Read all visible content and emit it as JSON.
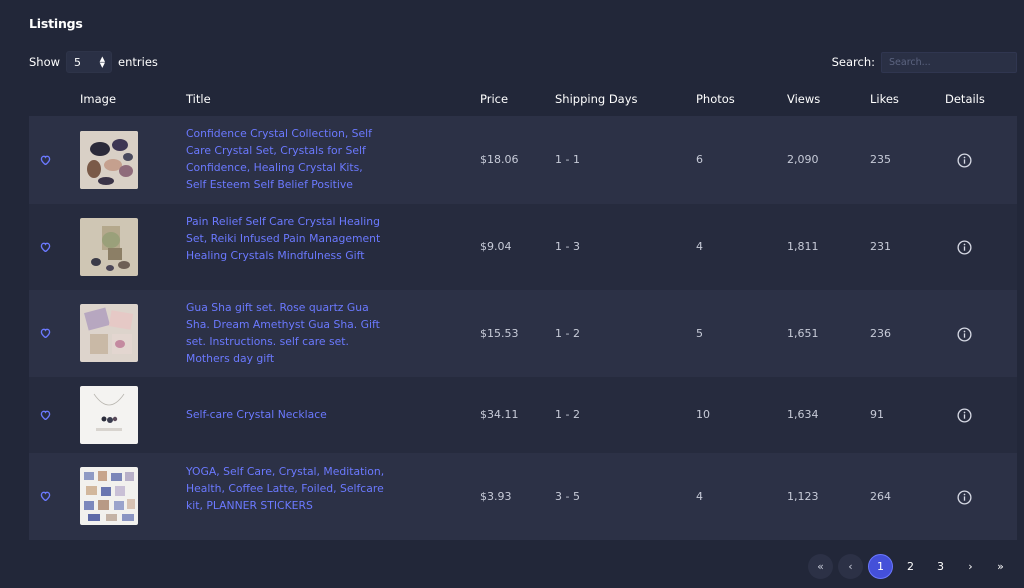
{
  "page_title": "Listings",
  "length_control": {
    "show_label": "Show",
    "value": "5",
    "entries_label": "entries"
  },
  "search": {
    "label": "Search:",
    "placeholder": "Search..."
  },
  "columns": [
    "Image",
    "Title",
    "Price",
    "Shipping Days",
    "Photos",
    "Views",
    "Likes",
    "Details"
  ],
  "rows": [
    {
      "title": "Confidence Crystal Collection, Self Care Crystal Set, Crystals for Self Confidence, Healing Crystal Kits, Self Esteem Self Belief Positive",
      "price": "$18.06",
      "shipping": "1 - 1",
      "photos": "6",
      "views": "2,090",
      "likes": "235"
    },
    {
      "title": "Pain Relief Self Care Crystal Healing Set, Reiki Infused Pain Management Healing Crystals Mindfulness Gift",
      "price": "$9.04",
      "shipping": "1 - 3",
      "photos": "4",
      "views": "1,811",
      "likes": "231"
    },
    {
      "title": "Gua Sha gift set. Rose quartz Gua Sha. Dream Amethyst Gua Sha. Gift set. Instructions. self care set. Mothers day gift",
      "price": "$15.53",
      "shipping": "1 - 2",
      "photos": "5",
      "views": "1,651",
      "likes": "236"
    },
    {
      "title": "Self-care Crystal Necklace",
      "price": "$34.11",
      "shipping": "1 - 2",
      "photos": "10",
      "views": "1,634",
      "likes": "91"
    },
    {
      "title": "YOGA, Self Care, Crystal, Meditation, Health, Coffee Latte, Foiled, Selfcare kit, PLANNER STICKERS",
      "price": "$3.93",
      "shipping": "3 - 5",
      "photos": "4",
      "views": "1,123",
      "likes": "264"
    }
  ],
  "pagination": {
    "first": "«",
    "prev": "‹",
    "pages": [
      "1",
      "2",
      "3"
    ],
    "current": "1",
    "next": "›",
    "last": "»"
  },
  "colors": {
    "background": "#222739",
    "row_odd": "#2c3146",
    "row_even": "#262b3e",
    "link": "#6b79ff",
    "accent": "#4450d9"
  },
  "icons": {
    "favorite": "heart-icon",
    "details": "info-icon",
    "sort": "updown-arrows-icon"
  }
}
